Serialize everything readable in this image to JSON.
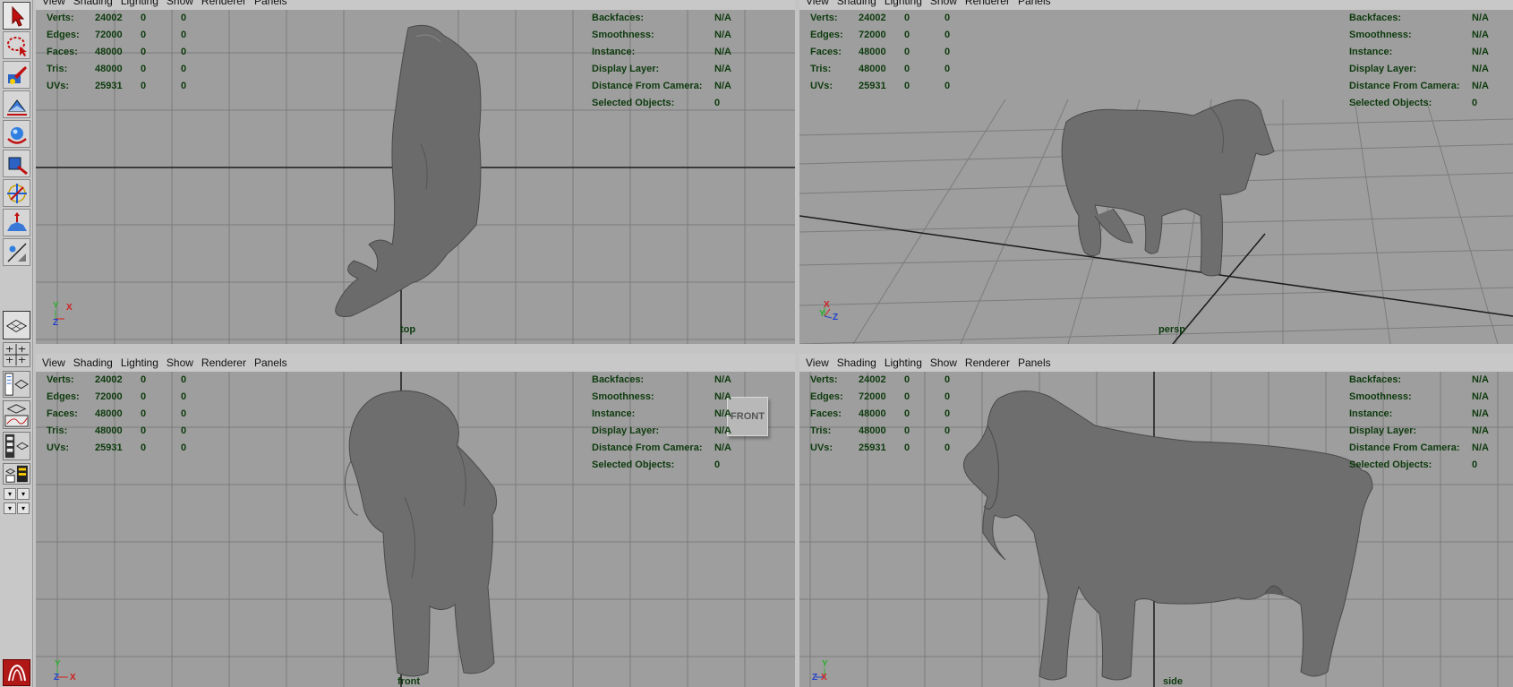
{
  "menus": [
    "View",
    "Shading",
    "Lighting",
    "Show",
    "Renderer",
    "Panels"
  ],
  "stats": {
    "labels": [
      "Verts:",
      "Edges:",
      "Faces:",
      "Tris:",
      "UVs:"
    ],
    "rows": [
      [
        "24002",
        "0",
        "0"
      ],
      [
        "72000",
        "0",
        "0"
      ],
      [
        "48000",
        "0",
        "0"
      ],
      [
        "48000",
        "0",
        "0"
      ],
      [
        "25931",
        "0",
        "0"
      ]
    ]
  },
  "info": {
    "labels": [
      "Backfaces:",
      "Smoothness:",
      "Instance:",
      "Display Layer:",
      "Distance From Camera:",
      "Selected Objects:"
    ],
    "values": [
      "N/A",
      "N/A",
      "N/A",
      "N/A",
      "N/A",
      "0"
    ]
  },
  "cameras": {
    "top": "top",
    "persp": "persp",
    "front": "front",
    "side": "side"
  },
  "axes": {
    "top": [
      "Y",
      "X",
      "Z"
    ],
    "persp": [
      "X",
      "Y",
      "Z"
    ],
    "front": [
      "Y",
      "Z",
      "X"
    ],
    "side": [
      "Y",
      "Z",
      "X"
    ]
  },
  "viewcube_label": "FRONT",
  "tools": [
    "select-tool",
    "lasso-tool",
    "paint-select-tool",
    "move-tool",
    "rotate-tool",
    "scale-tool",
    "universal-manipulator-tool",
    "soft-modification-tool",
    "show-manipulator-tool"
  ],
  "colors": {
    "viewport_bg": "#9e9e9e",
    "grid": "#7c7c7c",
    "axis_line": "#1a1a1a",
    "hud_text": "#0d3a0d",
    "model": "#6e6e6e"
  }
}
